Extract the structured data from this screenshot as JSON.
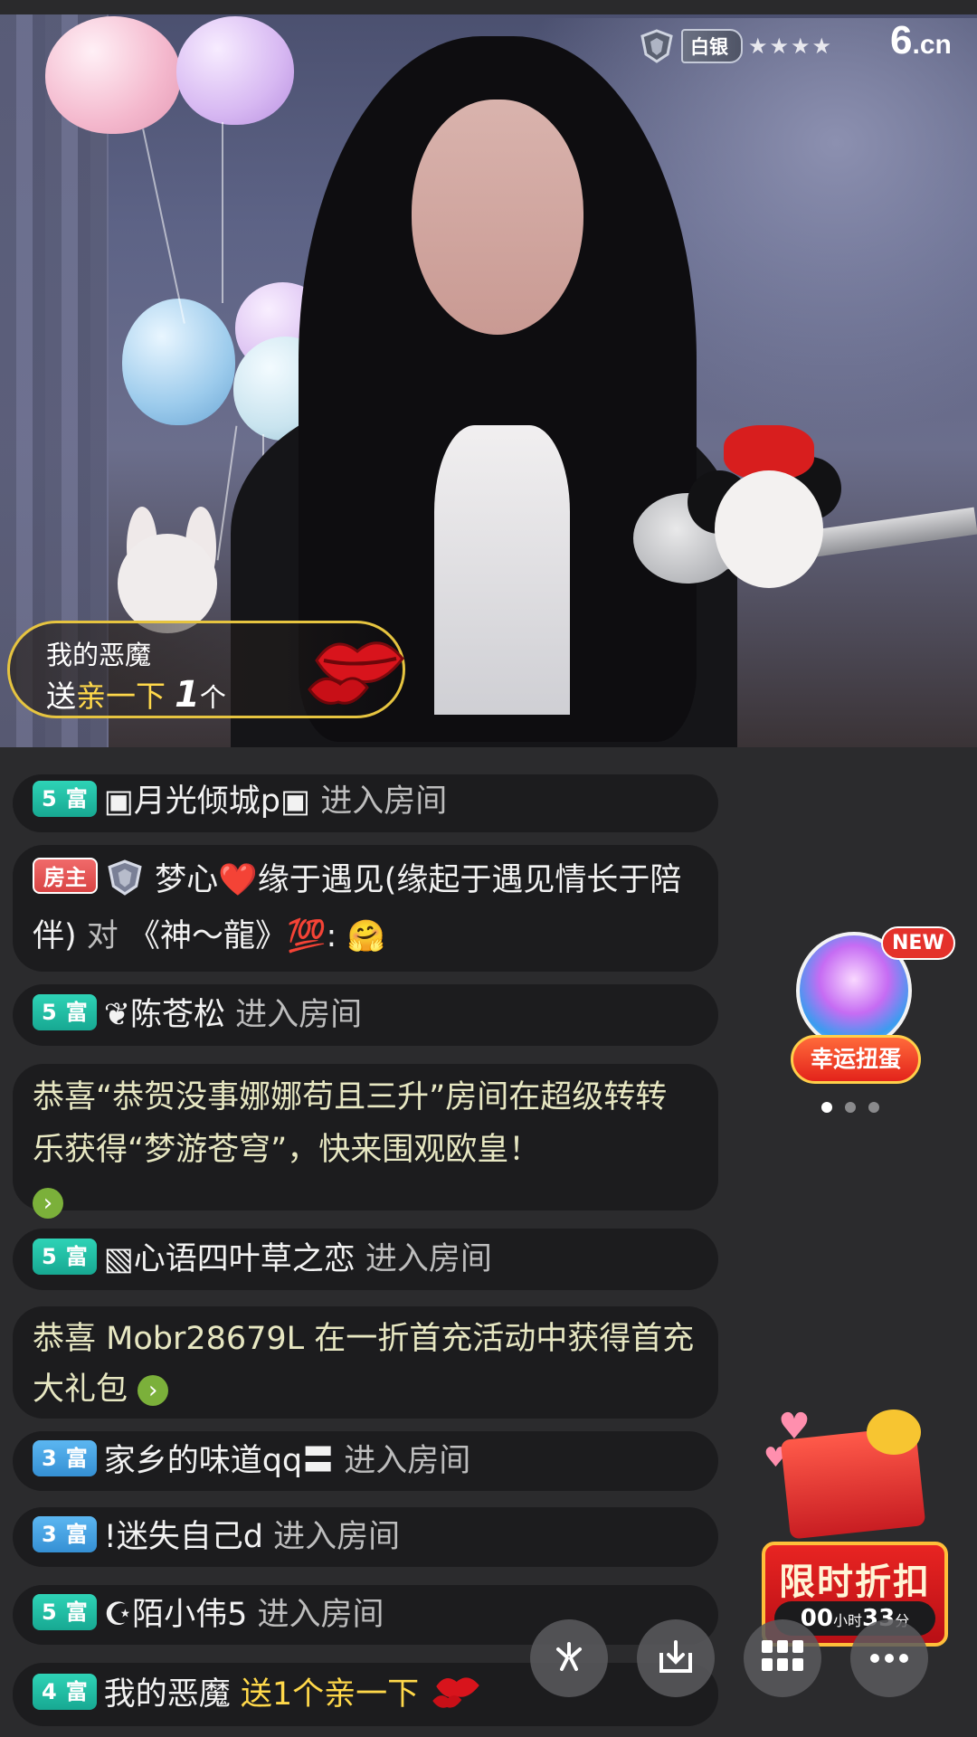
{
  "stream": {
    "level_text": "白银",
    "level_stars": "★★★★",
    "brand_logo": "6",
    "brand_suffix": ".cn"
  },
  "gift_popup": {
    "sender": "我的恶魔",
    "send_label": "送",
    "gift_name": "亲一下",
    "count": "1",
    "unit": "个",
    "gift_icon": "lips-icon"
  },
  "chat": [
    {
      "type": "enter",
      "badge_level": "5",
      "badge_text": "富",
      "name": "▣月光倾城p▣",
      "action": "进入房间"
    },
    {
      "type": "message",
      "badge_text": "房主",
      "name": "梦心❤️缘于遇见(缘起于遇见情长于陪伴)",
      "to_label": "对",
      "to_name": "《神～龍》💯",
      "content": ":",
      "emoji": "🤗"
    },
    {
      "type": "enter",
      "badge_level": "5",
      "badge_text": "富",
      "name": "❦陈苍松",
      "action": "进入房间"
    },
    {
      "type": "system",
      "text": "恭喜“恭贺没事娜娜苟且三升”房间在超级转转乐获得“梦游苍穹”，快来围观欧皇！"
    },
    {
      "type": "enter",
      "badge_level": "5",
      "badge_text": "富",
      "name": "▧心语四叶草之恋",
      "action": "进入房间"
    },
    {
      "type": "system",
      "text": "恭喜 Mobr28679L 在一折首充活动中获得首充大礼包"
    },
    {
      "type": "enter",
      "badge_level": "3",
      "badge_text": "富",
      "name": "家乡的味道qq〓",
      "action": "进入房间"
    },
    {
      "type": "enter",
      "badge_level": "3",
      "badge_text": "富",
      "name": "!迷失自己d",
      "action": "进入房间"
    },
    {
      "type": "enter",
      "badge_level": "5",
      "badge_text": "富",
      "name": "☪陌小伟5",
      "action": "进入房间"
    },
    {
      "type": "gift",
      "badge_level": "4",
      "badge_text": "富",
      "name": "我的恶魔",
      "gift_text": "送1个亲一下"
    }
  ],
  "widgets": {
    "lucky_egg_new": "NEW",
    "lucky_egg_label": "幸运扭蛋",
    "discount_title": "限时折扣",
    "discount_hours": "00",
    "discount_hours_unit": "小时",
    "discount_minutes": "33",
    "discount_minutes_unit": "分"
  },
  "actions": [
    {
      "name": "share-button",
      "icon": "share-icon"
    },
    {
      "name": "download-button",
      "icon": "download-icon"
    },
    {
      "name": "apps-button",
      "icon": "grid-icon"
    },
    {
      "name": "more-button",
      "icon": "more-icon"
    }
  ]
}
